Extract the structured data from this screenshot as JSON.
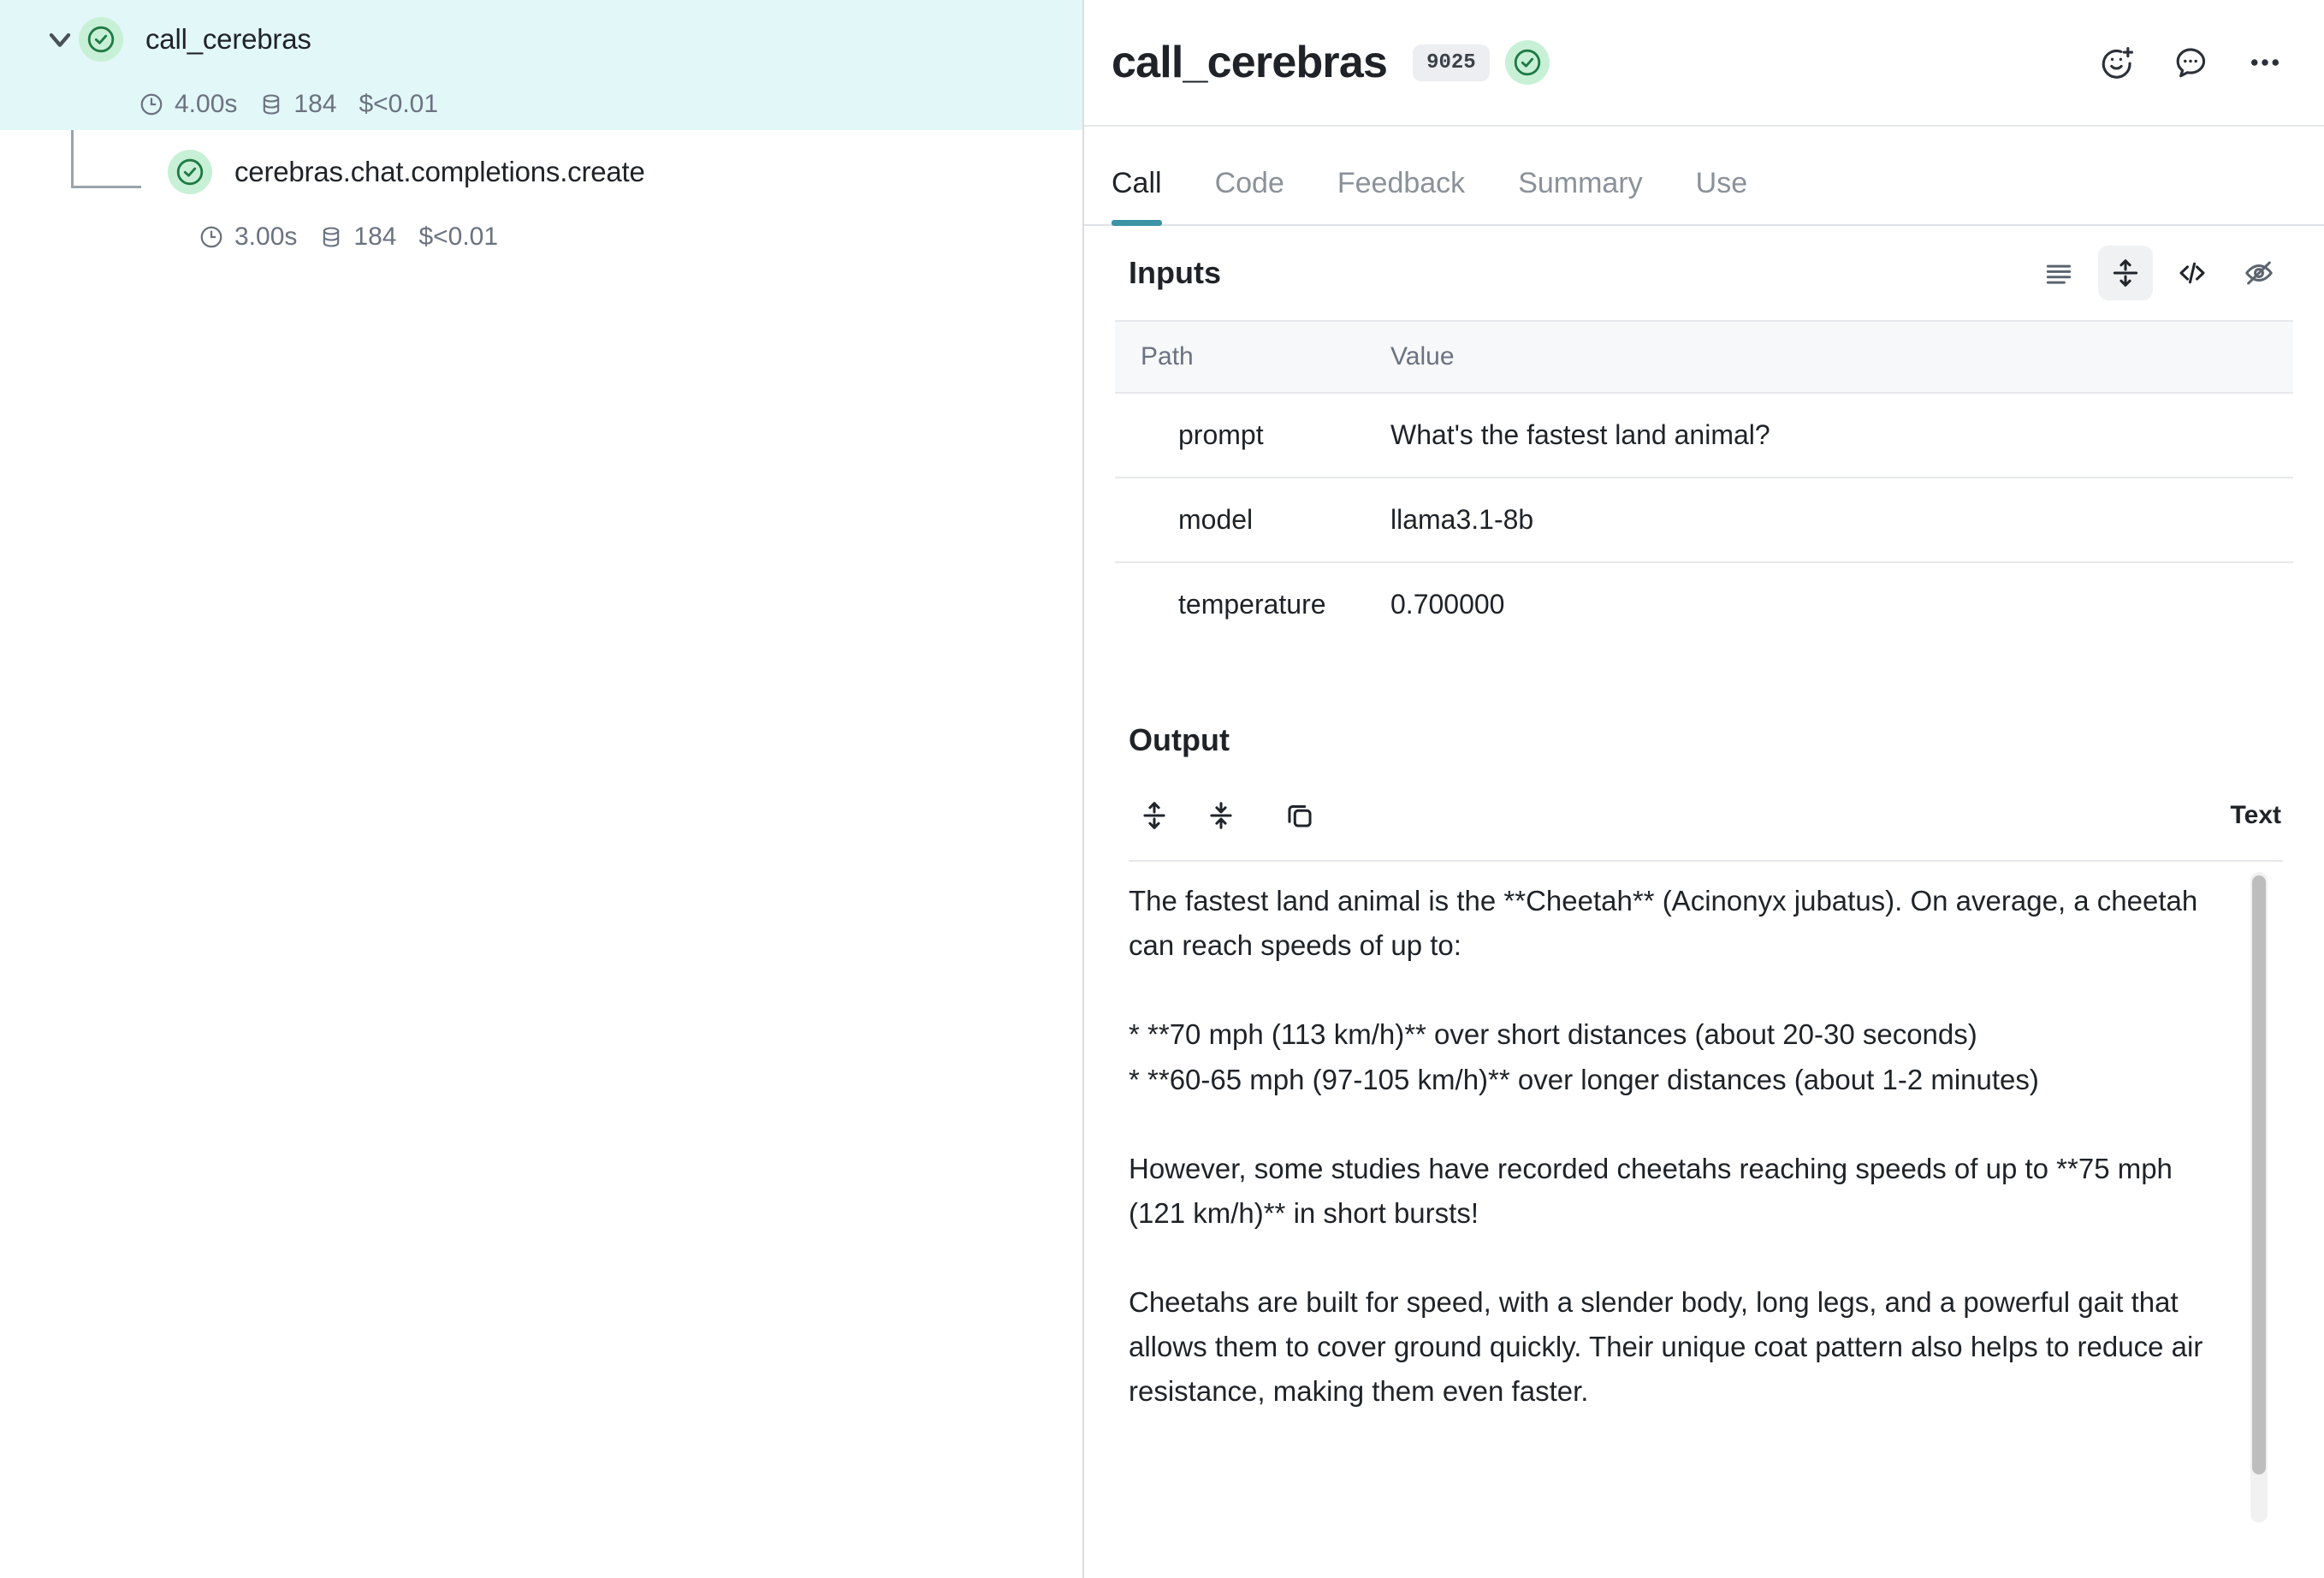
{
  "tree": {
    "nodes": [
      {
        "name": "call_cerebras",
        "status_icon": "check-circle-icon",
        "chevron_icon": "chevron-down-icon",
        "selected": true,
        "metrics": {
          "duration_icon": "clock-icon",
          "duration": "4.00s",
          "tokens_icon": "database-icon",
          "tokens": "184",
          "cost": "$<0.01"
        }
      },
      {
        "name": "cerebras.chat.completions.create",
        "status_icon": "check-circle-icon",
        "selected": false,
        "metrics": {
          "duration_icon": "clock-icon",
          "duration": "3.00s",
          "tokens_icon": "database-icon",
          "tokens": "184",
          "cost": "$<0.01"
        }
      }
    ]
  },
  "detail": {
    "title": "call_cerebras",
    "id_chip": "9025",
    "status_icon": "check-circle-icon",
    "header_actions": [
      {
        "name": "add-reaction-icon",
        "label": "Add reaction"
      },
      {
        "name": "comment-icon",
        "label": "Add comment"
      },
      {
        "name": "more-options-icon",
        "label": "More options"
      }
    ],
    "tabs": [
      {
        "label": "Call",
        "active": true
      },
      {
        "label": "Code",
        "active": false
      },
      {
        "label": "Feedback",
        "active": false
      },
      {
        "label": "Summary",
        "active": false
      },
      {
        "label": "Use",
        "active": false
      }
    ],
    "inputs": {
      "title": "Inputs",
      "view_buttons": [
        {
          "name": "list-view-icon",
          "active": false
        },
        {
          "name": "expand-vertical-icon",
          "active": true
        },
        {
          "name": "code-view-icon",
          "active": false
        },
        {
          "name": "hide-eye-icon",
          "active": false
        }
      ],
      "columns": [
        "Path",
        "Value"
      ],
      "rows": [
        {
          "path": "prompt",
          "value": "What's the fastest land animal?"
        },
        {
          "path": "model",
          "value": "llama3.1-8b"
        },
        {
          "path": "temperature",
          "value": "0.700000"
        }
      ]
    },
    "output": {
      "title": "Output",
      "toolbar": [
        {
          "name": "expand-all-icon"
        },
        {
          "name": "collapse-all-icon"
        },
        {
          "name": "copy-icon"
        }
      ],
      "format_label": "Text",
      "text": "The fastest land animal is the **Cheetah** (Acinonyx jubatus). On average, a cheetah can reach speeds of up to:\n\n* **70 mph (113 km/h)** over short distances (about 20-30 seconds)\n* **60-65 mph (97-105 km/h)** over longer distances (about 1-2 minutes)\n\nHowever, some studies have recorded cheetahs reaching speeds of up to **75 mph (121 km/h)** in short bursts!\n\nCheetahs are built for speed, with a slender body, long legs, and a powerful gait that allows them to cover ground quickly. Their unique coat pattern also helps to reduce air resistance, making them even faster."
    }
  },
  "colors": {
    "selected_row": "#e2f7f8",
    "accent_tab": "#3b93a6",
    "status_green_bg": "#c8f0d6",
    "status_green_fg": "#1f7a45",
    "muted_text": "#6b7280"
  }
}
